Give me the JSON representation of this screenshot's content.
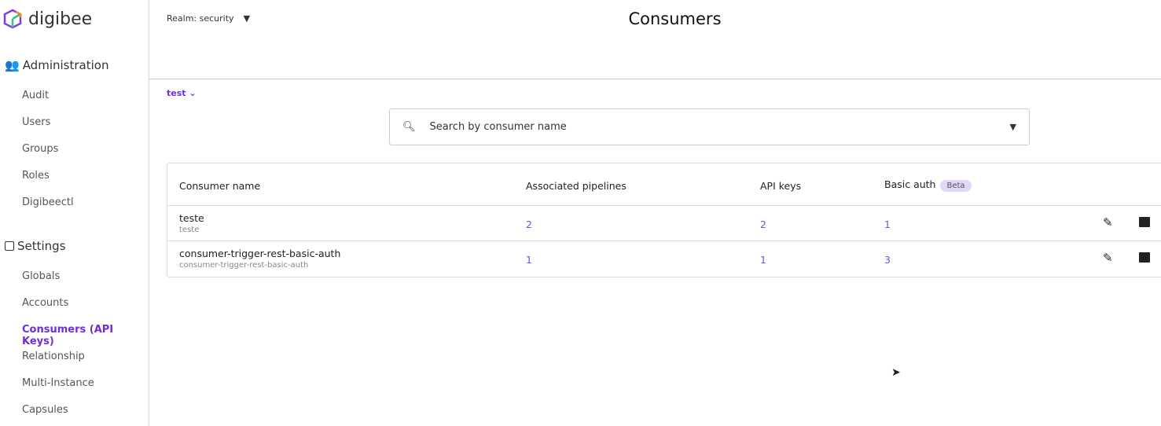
{
  "app": {
    "logo": "digibee"
  },
  "sidebar": {
    "administration": {
      "label": "Administration",
      "items": [
        "Audit",
        "Users",
        "Groups",
        "Roles",
        "Digibeectl"
      ]
    },
    "settings": {
      "label": "Settings",
      "items": [
        "Globals",
        "Accounts",
        "Consumers (API Keys)",
        "Relationship",
        "Multi-Instance",
        "Capsules"
      ]
    },
    "active": "Consumers (API Keys)"
  },
  "header": {
    "realm": "Realm: security",
    "title": "Consumers"
  },
  "env": "test",
  "search": {
    "placeholder": "Search by consumer name"
  },
  "table": {
    "headers": {
      "name": "Consumer name",
      "pipelines": "Associated pipelines",
      "api_keys": "API keys",
      "basic_auth": "Basic auth",
      "badge": "Beta"
    },
    "rows": [
      {
        "name": "teste",
        "sub": "teste",
        "pipelines": "2",
        "api_keys": "2",
        "basic_auth": "1"
      },
      {
        "name": "consumer-trigger-rest-basic-auth",
        "sub": "consumer-trigger-rest-basic-auth",
        "pipelines": "1",
        "api_keys": "1",
        "basic_auth": "3"
      }
    ]
  },
  "colors": {
    "accent": "#6e2fd6",
    "badge": "#e0d7fa"
  }
}
